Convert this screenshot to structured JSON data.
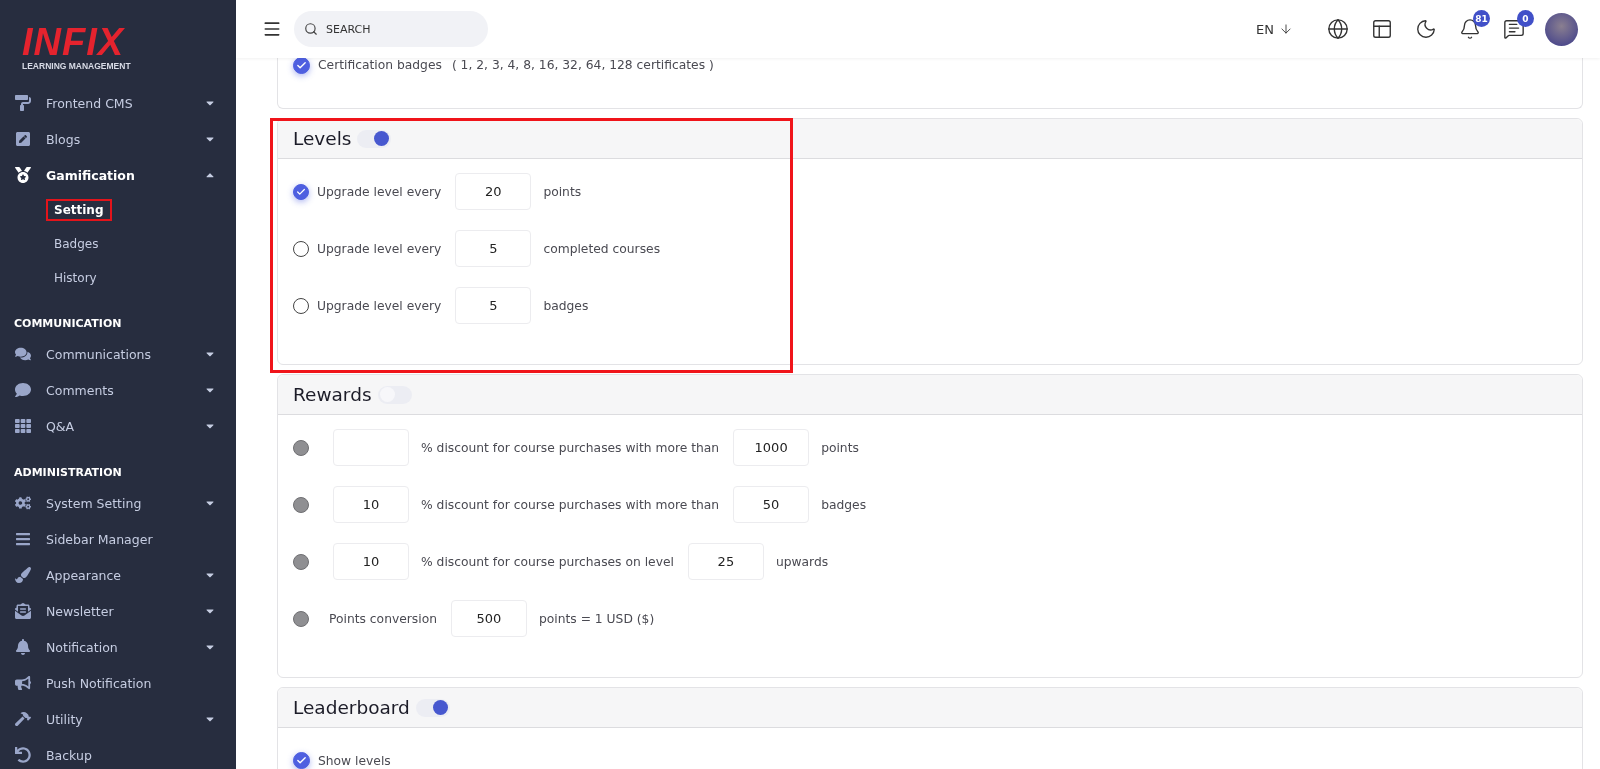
{
  "logo": {
    "wordmark": "INFIX",
    "tagline": "LEARNING MANAGEMENT"
  },
  "sidebar": {
    "groups": [
      {
        "items": [
          {
            "label": "Frontend CMS",
            "expanded": false
          },
          {
            "label": "Blogs",
            "expanded": false
          },
          {
            "label": "Gamification",
            "expanded": true,
            "children": [
              {
                "label": "Setting",
                "selected": true,
                "highlighted": true
              },
              {
                "label": "Badges",
                "selected": false,
                "highlighted": false
              },
              {
                "label": "History",
                "selected": false,
                "highlighted": false
              }
            ]
          }
        ]
      },
      {
        "heading": "COMMUNICATION",
        "items": [
          {
            "label": "Communications",
            "expanded": false
          },
          {
            "label": "Comments",
            "expanded": false
          },
          {
            "label": "Q&A",
            "expanded": false
          }
        ]
      },
      {
        "heading": "ADMINISTRATION",
        "items": [
          {
            "label": "System Setting",
            "expanded": false
          },
          {
            "label": "Sidebar Manager"
          },
          {
            "label": "Appearance",
            "expanded": false
          },
          {
            "label": "Newsletter",
            "expanded": false
          },
          {
            "label": "Notification",
            "expanded": false
          },
          {
            "label": "Push Notification"
          },
          {
            "label": "Utility",
            "expanded": false
          },
          {
            "label": "Backup"
          }
        ]
      }
    ]
  },
  "header": {
    "search": {
      "placeholder": "SEARCH"
    },
    "language": "EN",
    "notification_count": "81",
    "message_count": "0"
  },
  "sections": [
    {
      "rows": [
        {
          "kind": "checkbox",
          "checked": true,
          "parts": [
            {
              "kind": "text",
              "text": "Certification badges"
            },
            {
              "kind": "text",
              "text": "( 1, 2, 3, 4, 8, 16, 32, 64, 128 certificates )"
            }
          ]
        }
      ]
    },
    {
      "title": "Levels",
      "enabled": true,
      "highlighted": true,
      "rows": [
        {
          "kind": "radio",
          "selected": true,
          "parts": [
            {
              "kind": "text",
              "text": "Upgrade level every"
            },
            {
              "kind": "input",
              "value": "20"
            },
            {
              "kind": "text",
              "text": "points"
            }
          ]
        },
        {
          "kind": "radio",
          "selected": false,
          "parts": [
            {
              "kind": "text",
              "text": "Upgrade level every"
            },
            {
              "kind": "input",
              "value": "5"
            },
            {
              "kind": "text",
              "text": "completed courses"
            }
          ]
        },
        {
          "kind": "radio",
          "selected": false,
          "parts": [
            {
              "kind": "text",
              "text": "Upgrade level every"
            },
            {
              "kind": "input",
              "value": "5"
            },
            {
              "kind": "text",
              "text": "badges"
            }
          ]
        }
      ]
    },
    {
      "title": "Rewards",
      "enabled": false,
      "highlighted": false,
      "rows": [
        {
          "kind": "radio",
          "selected": false,
          "parts": [
            {
              "kind": "input"
            },
            {
              "kind": "text",
              "text": "% discount for course purchases with more than"
            },
            {
              "kind": "input",
              "value": "1000"
            },
            {
              "kind": "text",
              "text": "points"
            }
          ]
        },
        {
          "kind": "radio",
          "selected": false,
          "parts": [
            {
              "kind": "input",
              "value": "10"
            },
            {
              "kind": "text",
              "text": "% discount for course purchases with more than"
            },
            {
              "kind": "input",
              "value": "50"
            },
            {
              "kind": "text",
              "text": "badges"
            }
          ]
        },
        {
          "kind": "radio",
          "selected": false,
          "parts": [
            {
              "kind": "input",
              "value": "10"
            },
            {
              "kind": "text",
              "text": "% discount for course purchases on level"
            },
            {
              "kind": "input",
              "value": "25"
            },
            {
              "kind": "text",
              "text": "upwards"
            }
          ]
        },
        {
          "kind": "radio",
          "selected": false,
          "parts": [
            {
              "kind": "text",
              "text": "Points conversion"
            },
            {
              "kind": "input",
              "value": "500"
            },
            {
              "kind": "text",
              "text": "points = 1 USD ($)"
            }
          ]
        }
      ]
    },
    {
      "title": "Leaderboard",
      "enabled": true,
      "highlighted": false,
      "rows": [
        {
          "kind": "checkbox",
          "checked": true,
          "parts": [
            {
              "kind": "text",
              "text": "Show levels"
            }
          ]
        }
      ]
    }
  ]
}
